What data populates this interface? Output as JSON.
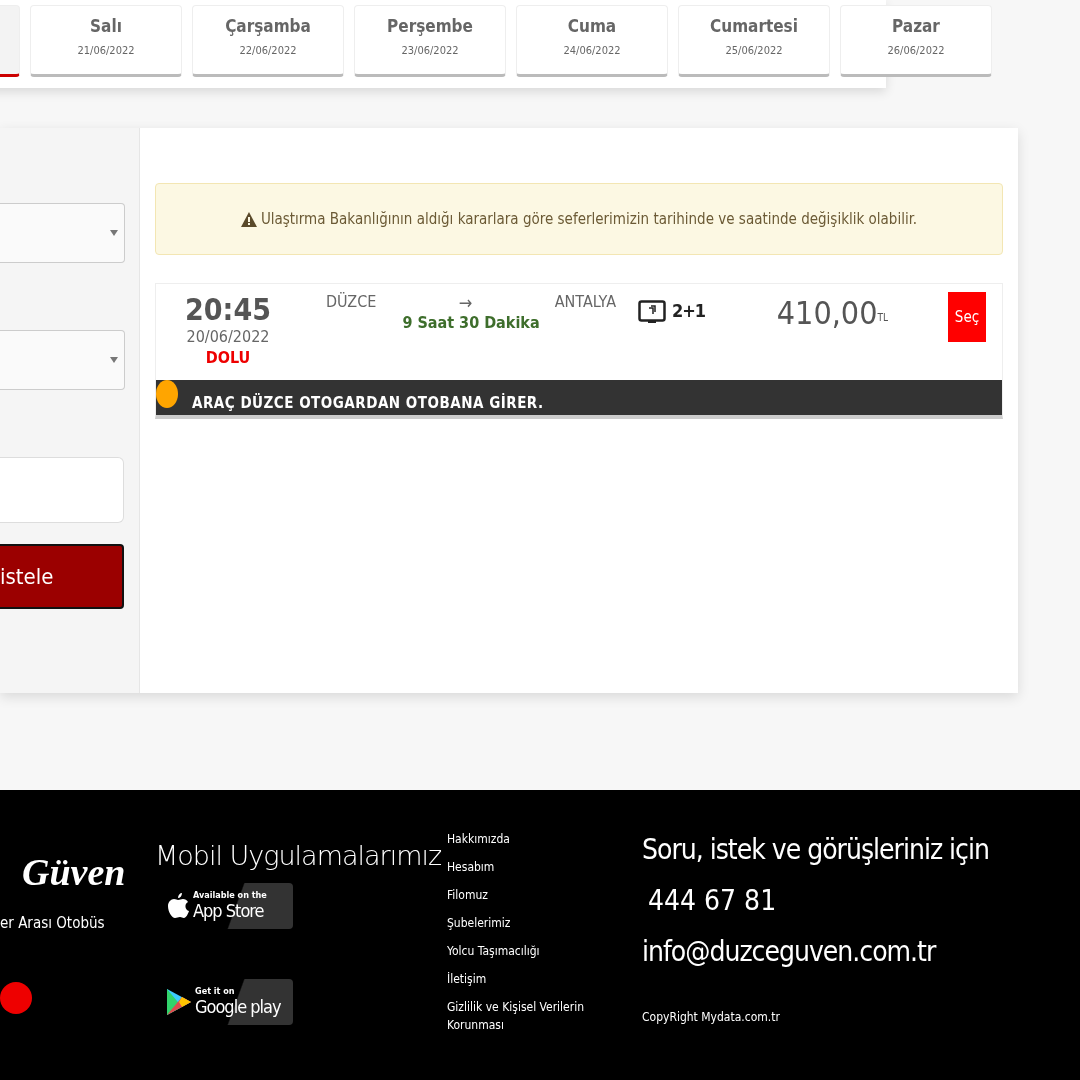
{
  "day_tabs": [
    {
      "selected": true
    },
    {
      "label": "Salı",
      "date": "21/06/2022",
      "selected": false
    },
    {
      "label": "Çarşamba",
      "date": "22/06/2022",
      "selected": false
    },
    {
      "label": "Perşembe",
      "date": "23/06/2022",
      "selected": false
    },
    {
      "label": "Cuma",
      "date": "24/06/2022",
      "selected": false
    },
    {
      "label": "Cumartesi",
      "date": "25/06/2022",
      "selected": false
    },
    {
      "label": "Pazar",
      "date": "26/06/2022",
      "selected": false
    }
  ],
  "search_form": {
    "fields": [
      {
        "kind": "select"
      },
      {
        "kind": "select"
      },
      {
        "kind": "input"
      }
    ],
    "button": "istele"
  },
  "notice": "Ulaştırma Bakanlığının aldığı kararlara göre seferlerimizin tarihinde ve saatinde değişiklik olabilir.",
  "trips": [
    {
      "time": "20:45",
      "date": "20/06/2022",
      "status": "DOLU",
      "from": "DÜZCE",
      "arrow": "→",
      "to": "ANTALYA",
      "duration": "9 Saat 30 Dakika",
      "seat_layout": "2+1",
      "price": "410,00",
      "currency": "TL",
      "select_button": "Seç",
      "note": "ARAÇ DÜZCE OTOGARDAN OTOBANA GİRER."
    }
  ],
  "footer": {
    "logo": "Güven",
    "tagline": "er Arası Otobüs",
    "apps_title": "Mobil Uygulamalarımız",
    "app_store": {
      "small": "Available on the",
      "big": "App Store"
    },
    "google_play": {
      "small": "Get it on",
      "big": "Google play"
    },
    "links": [
      "Hakkımızda",
      "Hesabım",
      "Filomuz",
      "Şubelerimiz",
      "Yolcu Taşımacılığı",
      "İletişim",
      "Gizlilik ve Kişisel Verilerin Korunması"
    ],
    "contact_title": "Soru, istek ve görüşleriniz için",
    "phone": "444 67 81",
    "email": "info@duzceguven.com.tr",
    "copyright": "CopyRight Mydata.com.tr"
  }
}
